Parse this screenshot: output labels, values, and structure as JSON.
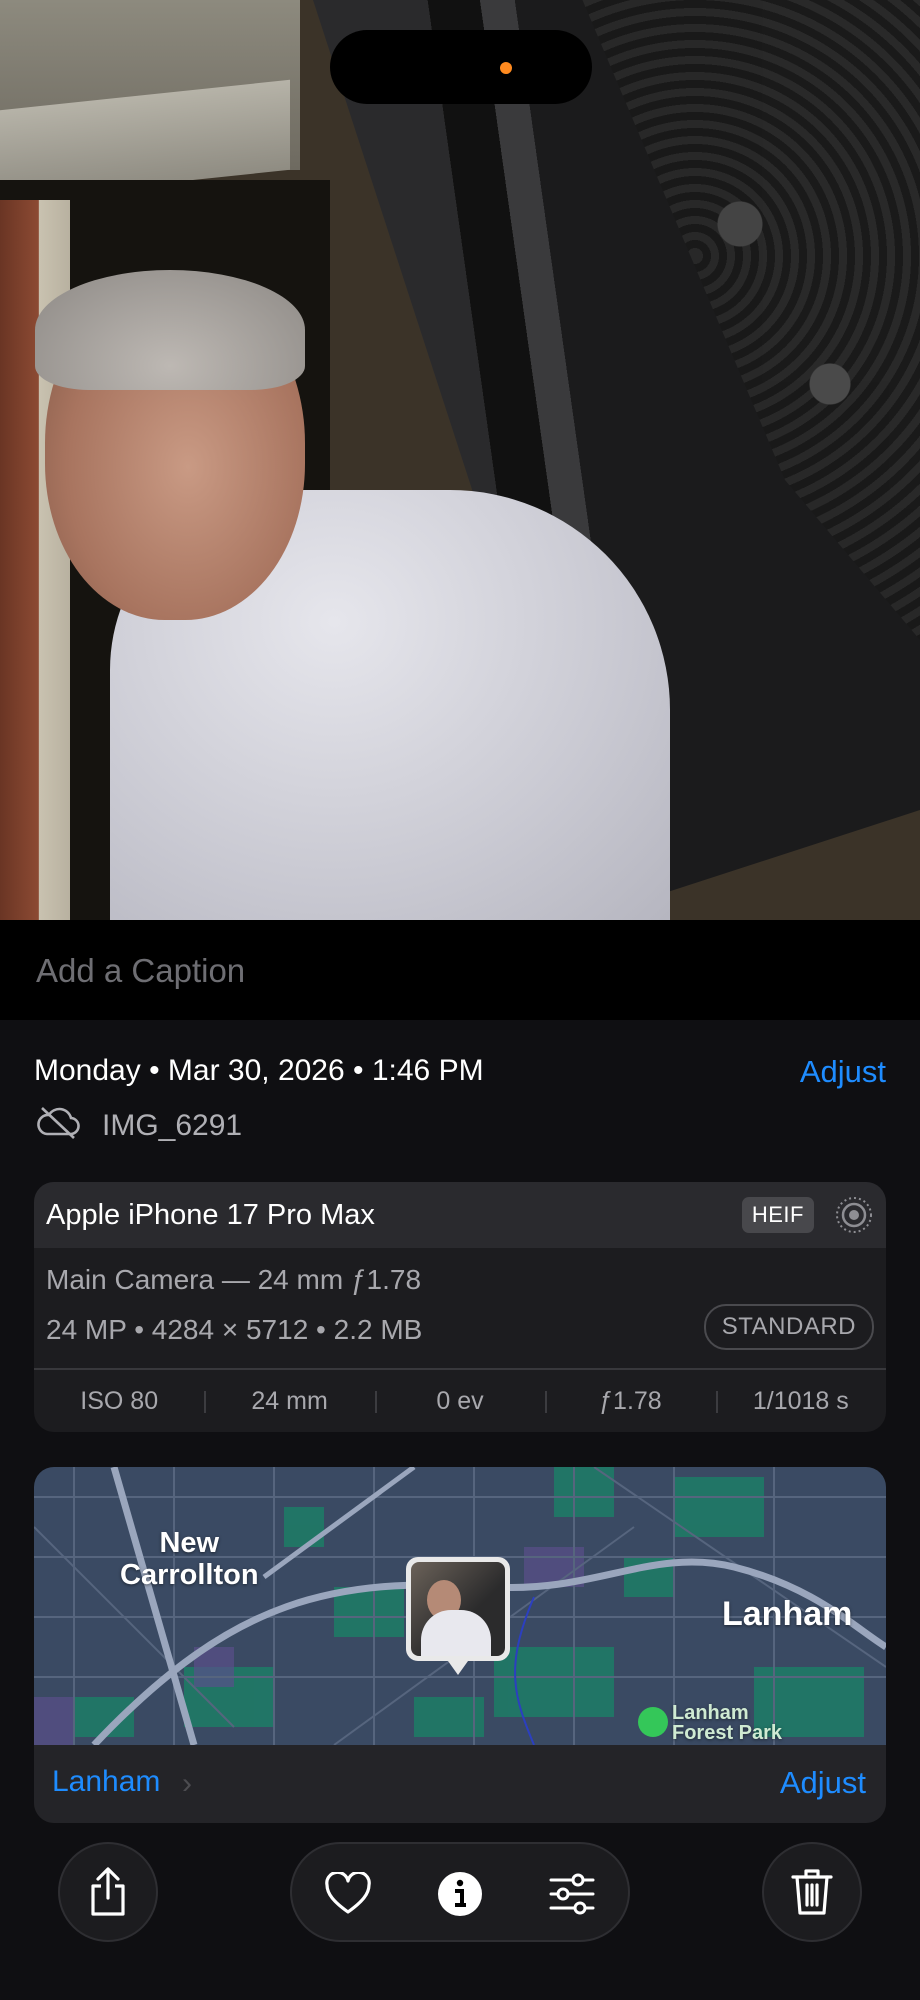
{
  "caption": {
    "placeholder": "Add a Caption"
  },
  "info": {
    "date_line": "Monday • Mar 30, 2026 • 1:46 PM",
    "adjust_label": "Adjust",
    "filename": "IMG_6291"
  },
  "exif": {
    "device": "Apple iPhone 17 Pro Max",
    "format_badge": "HEIF",
    "lens": "Main Camera — 24 mm ƒ1.78",
    "specs": "24 MP • 4284 × 5712 • 2.2 MB",
    "style_badge": "STANDARD",
    "iso": "ISO 80",
    "focal": "24 mm",
    "ev": "0 ev",
    "aperture": "ƒ1.78",
    "shutter": "1/1018 s"
  },
  "map": {
    "label_new_carrollton_1": "New",
    "label_new_carrollton_2": "Carrollton",
    "label_lanham": "Lanham",
    "label_park_1": "Lanham",
    "label_park_2": "Forest Park",
    "place": "Lanham",
    "adjust_label": "Adjust"
  },
  "colors": {
    "accent": "#1e8cff",
    "background": "#0f0f12",
    "card": "#1c1c1f",
    "status_dot": "#ff8a1f"
  },
  "icons": {
    "share": "share-icon",
    "favorite": "heart-icon",
    "info": "info-icon",
    "edit": "sliders-icon",
    "delete": "trash-icon",
    "cloud": "cloud-off-icon",
    "live": "live-photo-icon"
  }
}
